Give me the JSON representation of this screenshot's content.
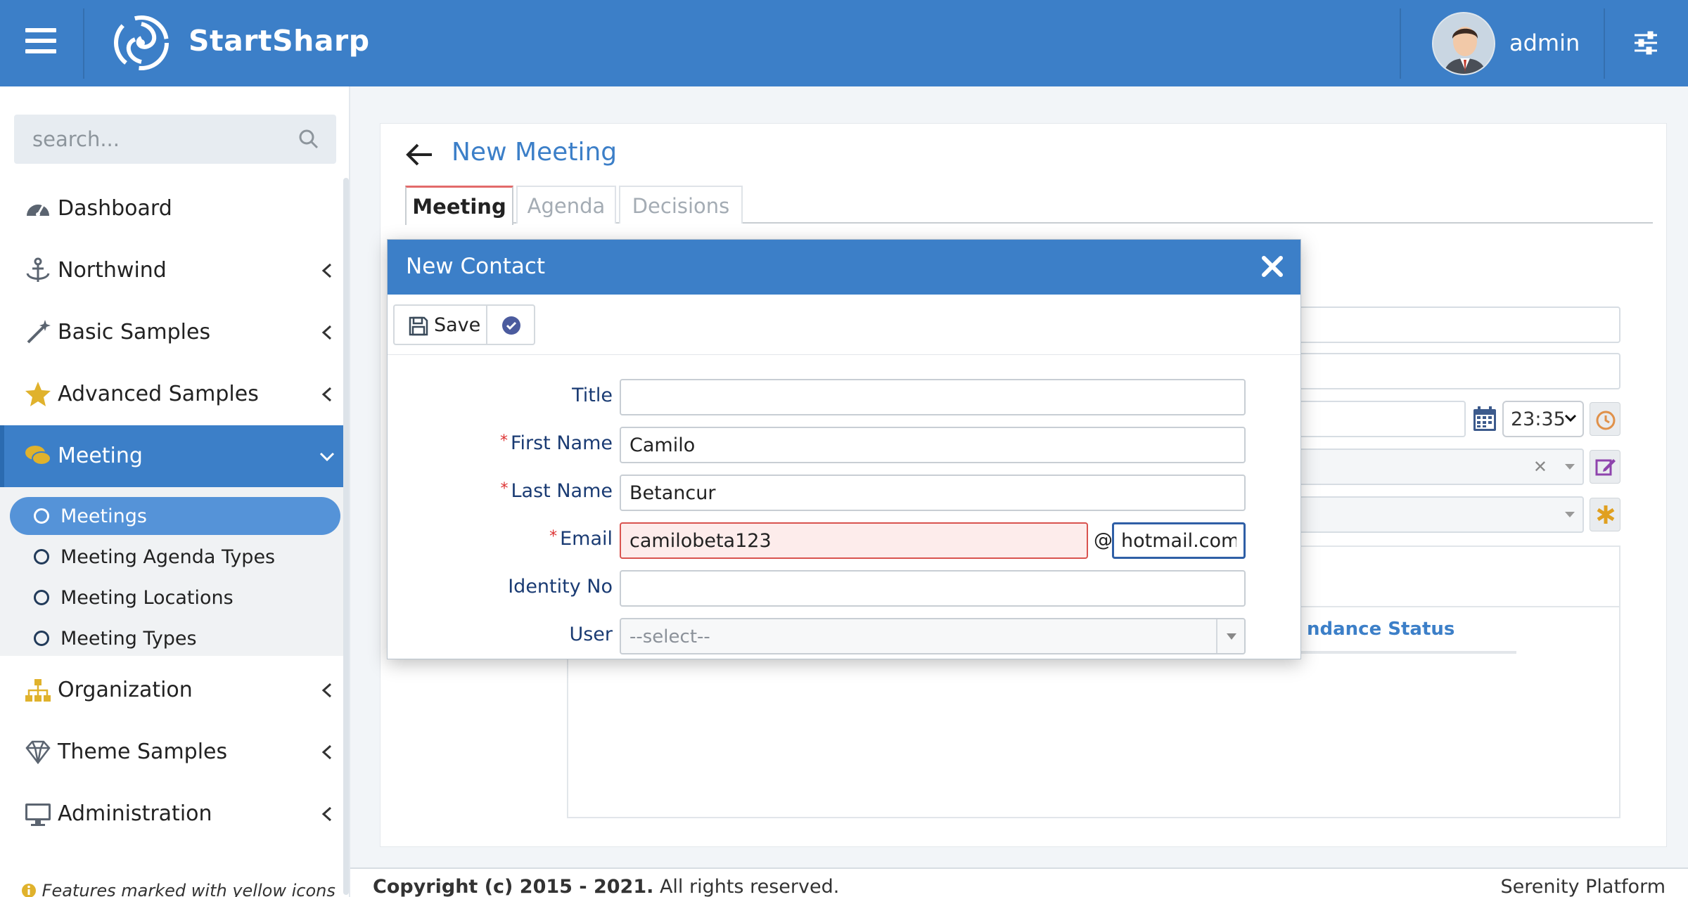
{
  "app": {
    "brand": "StartSharp",
    "username": "admin"
  },
  "search": {
    "placeholder": "search..."
  },
  "sidebar": {
    "items": [
      {
        "label": "Dashboard"
      },
      {
        "label": "Northwind"
      },
      {
        "label": "Basic Samples"
      },
      {
        "label": "Advanced Samples"
      },
      {
        "label": "Meeting"
      },
      {
        "label": "Organization"
      },
      {
        "label": "Theme Samples"
      },
      {
        "label": "Administration"
      }
    ],
    "meeting_sub": [
      {
        "label": "Meetings"
      },
      {
        "label": "Meeting Agenda Types"
      },
      {
        "label": "Meeting Locations"
      },
      {
        "label": "Meeting Types"
      }
    ],
    "note": "Features marked with yellow icons"
  },
  "page": {
    "title": "New Meeting",
    "tabs": [
      {
        "label": "Meeting"
      },
      {
        "label": "Agenda"
      },
      {
        "label": "Decisions"
      }
    ],
    "time_value": "23:35",
    "bg_column": "ndance Status"
  },
  "dialog": {
    "title": "New Contact",
    "save_label": "Save",
    "fields": {
      "title": {
        "label": "Title",
        "value": ""
      },
      "first_name": {
        "label": "First Name",
        "value": "Camilo"
      },
      "last_name": {
        "label": "Last Name",
        "value": "Betancur"
      },
      "email": {
        "label": "Email",
        "user": "camilobeta123",
        "at": "@",
        "domain": "hotmail.com"
      },
      "identity_no": {
        "label": "Identity No",
        "value": ""
      },
      "user": {
        "label": "User",
        "placeholder": "--select--"
      }
    },
    "required_mark": "*"
  },
  "footer": {
    "copyright_bold": "Copyright (c) 2015 - 2021.",
    "copyright_rest": " All rights reserved.",
    "platform": "Serenity Platform"
  },
  "colors": {
    "primary": "#3c7fc8",
    "active_sub": "#5593d8",
    "label": "#1a3b73",
    "error_bg": "#fdeceb"
  }
}
